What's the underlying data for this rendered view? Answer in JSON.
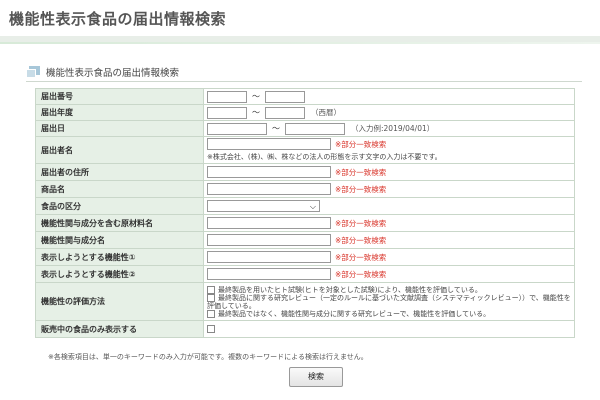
{
  "page": {
    "title": "機能性表示食品の届出情報検索"
  },
  "section": {
    "heading": "機能性表示食品の届出情報検索"
  },
  "form": {
    "tilde": "～",
    "partial_match": "※部分一致検索",
    "rows": {
      "notification_number": {
        "label": "届出番号"
      },
      "notification_year": {
        "label": "届出年度",
        "hint": "（西暦）"
      },
      "notification_date": {
        "label": "届出日",
        "hint": "（入力例:2019/04/01）"
      },
      "notifier_name": {
        "label": "届出者名",
        "note": "※株式会社、(株)、㈱、株などの法人の形態を示す文字の入力は不要です。"
      },
      "notifier_address": {
        "label": "届出者の住所"
      },
      "product_name": {
        "label": "商品名"
      },
      "food_category": {
        "label": "食品の区分",
        "selected": ""
      },
      "functional_ingredient_material": {
        "label": "機能性関与成分を含む原材料名"
      },
      "functional_ingredient_name": {
        "label": "機能性関与成分名"
      },
      "function_claim_1": {
        "label": "表示しようとする機能性①"
      },
      "function_claim_2": {
        "label": "表示しようとする機能性②"
      },
      "evaluation_method": {
        "label": "機能性の評価方法",
        "options": [
          "最終製品を用いたヒト試験(ヒトを対象とした試験)により、機能性を評価している。",
          "最終製品に関する研究レビュー（一定のルールに基づいた文献調査（システマティックレビュー））で、機能性を評価している。",
          "最終製品ではなく、機能性関与成分に関する研究レビューで、機能性を評価している。"
        ]
      },
      "on_sale_only": {
        "label": "販売中の食品のみ表示する",
        "checked": false
      }
    }
  },
  "footnote": "※各検索項目は、単一のキーワードのみ入力が可能です。複数のキーワードによる検索は行えません。",
  "search_button": {
    "label": "検索"
  }
}
